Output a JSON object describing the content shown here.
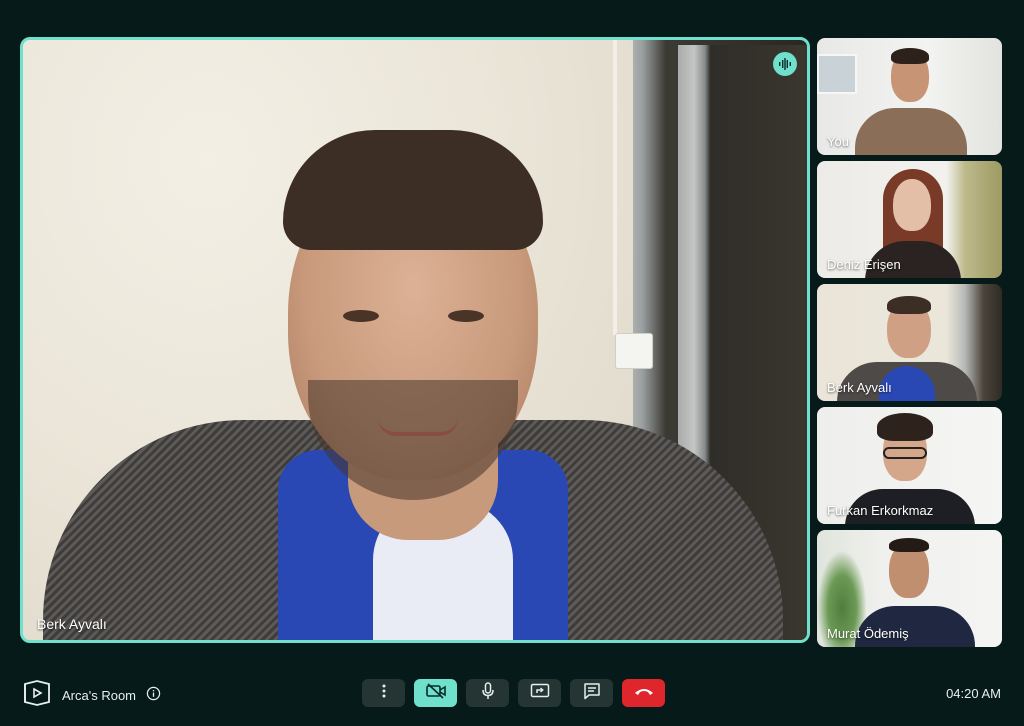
{
  "main": {
    "speaker_name": "Berk Ayvalı",
    "speaking_icon": "audio-wave-icon"
  },
  "participants": [
    {
      "name": "You"
    },
    {
      "name": "Deniz Erişen"
    },
    {
      "name": "Berk Ayvalı"
    },
    {
      "name": "Furkan Erkorkmaz"
    },
    {
      "name": "Murat Ödemiş"
    }
  ],
  "bottom_bar": {
    "room_name": "Arca's Room",
    "logo_icon": "room-logo-icon",
    "info_icon": "info-icon",
    "controls": [
      {
        "icon": "more-vertical-icon",
        "state": "default"
      },
      {
        "icon": "camera-off-icon",
        "state": "active"
      },
      {
        "icon": "microphone-icon",
        "state": "default"
      },
      {
        "icon": "screen-share-icon",
        "state": "default"
      },
      {
        "icon": "chat-icon",
        "state": "default"
      },
      {
        "icon": "end-call-icon",
        "state": "danger"
      }
    ],
    "time": "04:20 AM"
  },
  "colors": {
    "background": "#061a19",
    "accent": "#6fe0cc",
    "danger": "#e0262d",
    "control_bg": "#243533"
  }
}
